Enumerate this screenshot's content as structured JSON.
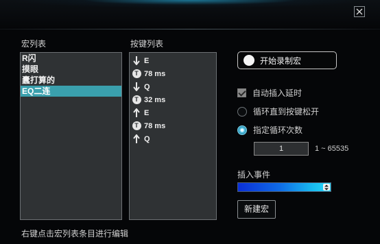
{
  "window": {
    "close_icon": "close-icon"
  },
  "macro_list": {
    "title": "宏列表",
    "items": [
      {
        "label": "R闪",
        "selected": false
      },
      {
        "label": "摸眼",
        "selected": false
      },
      {
        "label": "蠹打算的",
        "selected": false
      },
      {
        "label": "EQ二连",
        "selected": true
      }
    ]
  },
  "key_list": {
    "title": "按键列表",
    "items": [
      {
        "icon": "arrow-down-icon",
        "text": "E"
      },
      {
        "icon": "timer-icon",
        "text": "78 ms"
      },
      {
        "icon": "arrow-down-icon",
        "text": "Q"
      },
      {
        "icon": "timer-icon",
        "text": "32 ms"
      },
      {
        "icon": "arrow-up-icon",
        "text": "E"
      },
      {
        "icon": "timer-icon",
        "text": "78 ms"
      },
      {
        "icon": "arrow-up-icon",
        "text": "Q"
      }
    ],
    "timer_glyph": "T"
  },
  "record": {
    "label": "开始录制宏"
  },
  "options": {
    "auto_delay": {
      "label": "自动插入延时",
      "checked": true
    },
    "loop_until_release": {
      "label": "循环直到按键松开",
      "selected": false
    },
    "loop_count": {
      "label": "指定循环次数",
      "selected": true
    }
  },
  "loop_count_input": {
    "value": "1",
    "range": "1 ~ 65535"
  },
  "insert_event": {
    "label": "插入事件"
  },
  "new_macro": {
    "label": "新建宏"
  },
  "hint": {
    "text": "右键点击宏列表条目进行编辑"
  },
  "colors": {
    "accent": "#3aa0ad",
    "panel": "#2f3234",
    "background": "#050608"
  }
}
